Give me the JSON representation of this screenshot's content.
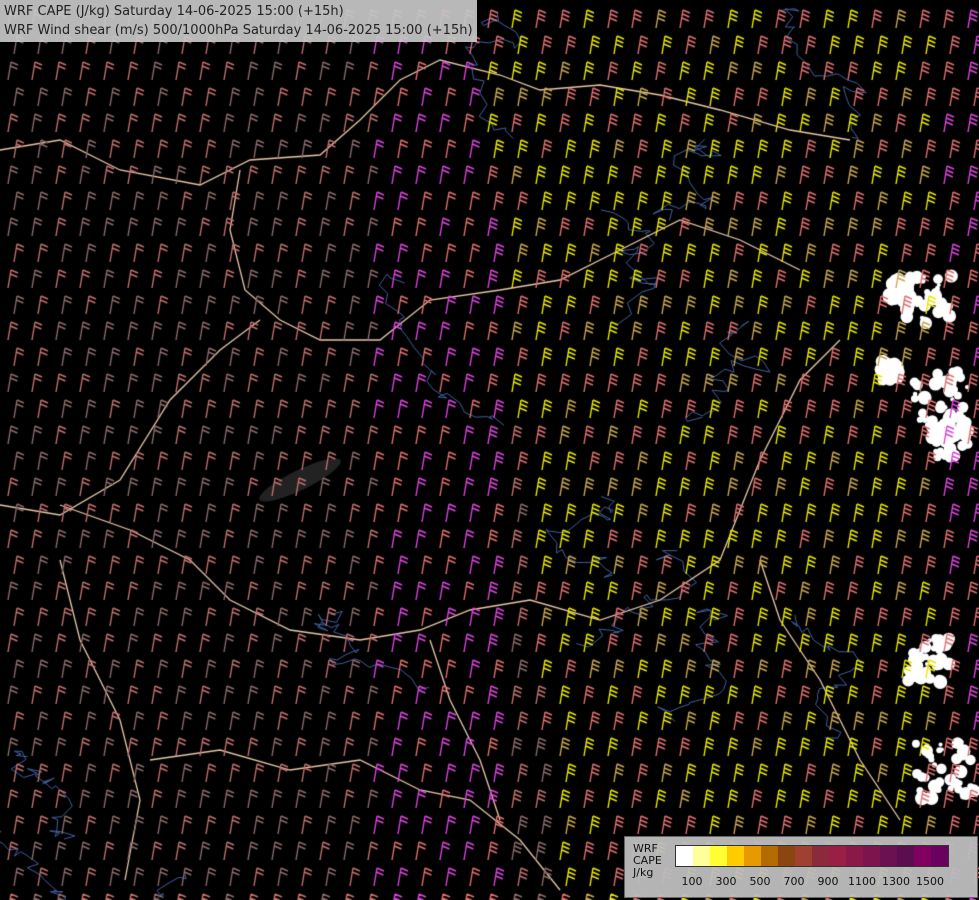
{
  "header": {
    "line1": "WRF CAPE (J/kg) Saturday 14-06-2025 15:00 (+15h)",
    "line2": "WRF Wind shear (m/s) 500/1000hPa Saturday 14-06-2025 15:00 (+15h)"
  },
  "legend": {
    "line1": "WRF",
    "line2": "CAPE",
    "line3": "J/kg",
    "colors": [
      "#ffffff",
      "#ffff99",
      "#ffff33",
      "#ffcc00",
      "#e69a00",
      "#b36b00",
      "#8b4513",
      "#a04030",
      "#8b2a3c",
      "#9a1f45",
      "#8a1848",
      "#7d1450",
      "#6b1050",
      "#5c0d50",
      "#800060",
      "#6a0060"
    ],
    "ticks": [
      "100",
      "300",
      "500",
      "700",
      "900",
      "1100",
      "1300",
      "1500"
    ]
  },
  "map": {
    "background": "#000000",
    "border_color": "#e8c8a8",
    "river_color": "#4060a0",
    "barb_colors": [
      "#8a6a6a",
      "#c07070",
      "#e07070",
      "#dd44dd",
      "#e8e800",
      "#c8a850"
    ]
  }
}
